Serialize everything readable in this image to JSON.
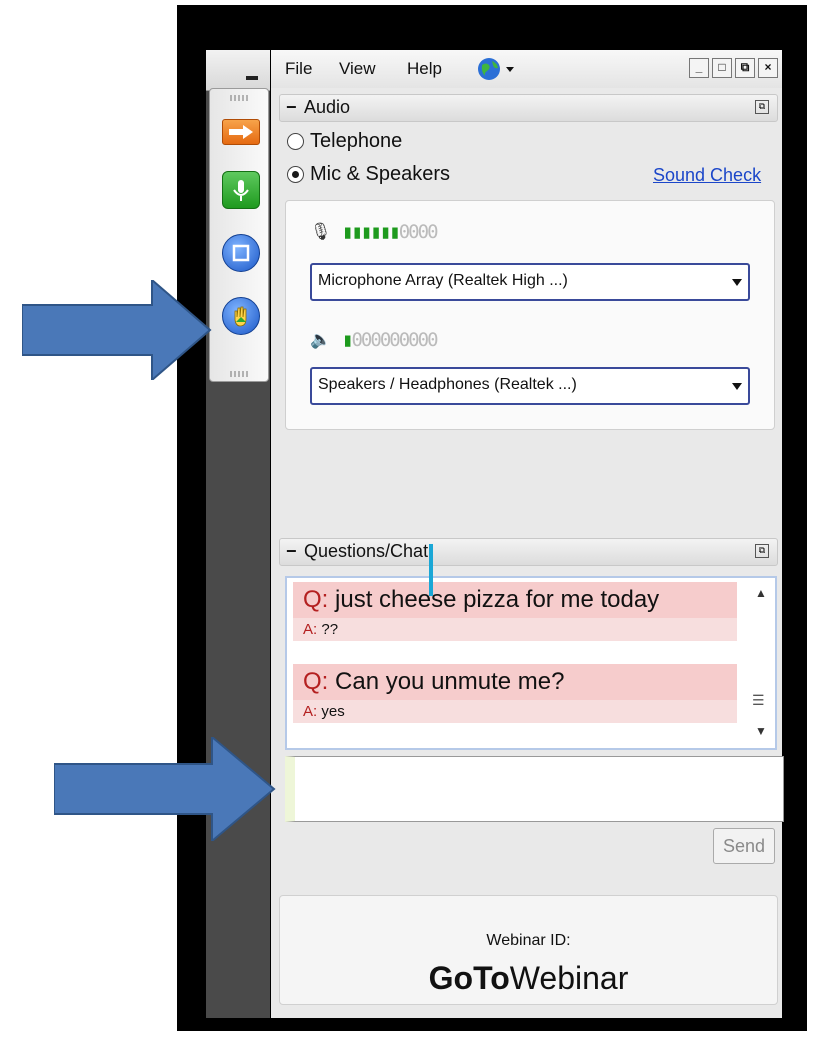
{
  "menubar": {
    "items": [
      "File",
      "View",
      "Help"
    ],
    "window_buttons": [
      "_",
      "□",
      "⧉",
      "×"
    ]
  },
  "audio": {
    "section_title": "Audio",
    "toggle": "−",
    "options": [
      {
        "label": "Telephone",
        "selected": false
      },
      {
        "label": "Mic & Speakers",
        "selected": true
      }
    ],
    "sound_check_label": "Sound Check",
    "mic_level": {
      "filled": 6,
      "total": 10
    },
    "speaker_level": {
      "filled": 1,
      "total": 10
    },
    "mic_device": "Microphone Array (Realtek High ...)",
    "speaker_device": "Speakers / Headphones (Realtek ...)"
  },
  "chat": {
    "section_title": "Questions/Chat",
    "toggle": "−",
    "messages": [
      {
        "q_label": "Q:",
        "question": " just cheese pizza for me today",
        "a_label": "A:",
        "answer": " ??"
      },
      {
        "q_label": "Q:",
        "question": " Can you unmute me?",
        "a_label": "A:",
        "answer": " yes"
      }
    ],
    "send_label": "Send"
  },
  "footer": {
    "webinar_id_label": "Webinar ID:",
    "brand_bold": "GoTo",
    "brand_regular": "Webinar"
  },
  "colors": {
    "annotation_arrow": "#4a78b8",
    "link": "#1b46c9",
    "question_bg": "#f6cccc",
    "level_on": "#1d9a1d"
  },
  "icons": [
    "arrow-panel-icon",
    "microphone-icon",
    "screen-icon",
    "raise-hand-icon",
    "globe-icon",
    "speaker-icon"
  ]
}
